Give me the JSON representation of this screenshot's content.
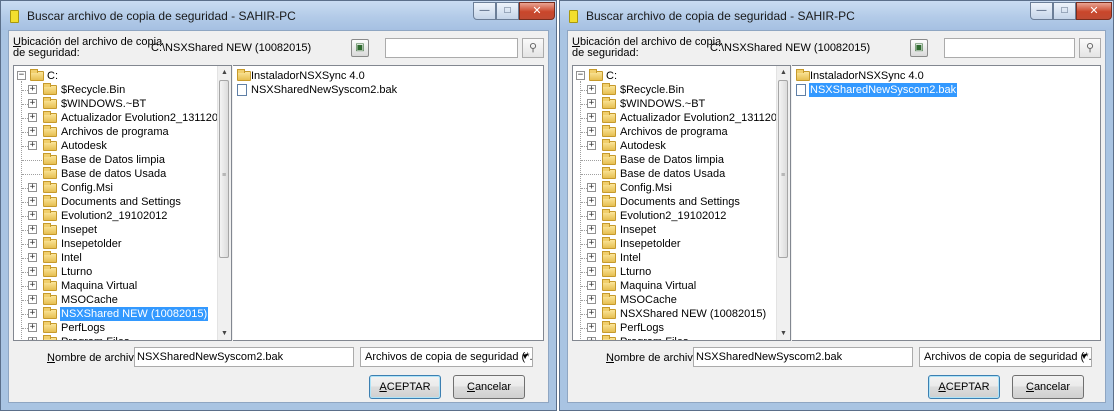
{
  "window": {
    "title": "Buscar archivo de copia de seguridad - SAHIR-PC",
    "minimize": "—",
    "maximize": "□",
    "close": "✕"
  },
  "location": {
    "label_line1_accesskey": "U",
    "label_line1_rest": "bicación del archivo de copia",
    "label_line2": "de seguridad:",
    "path": "C:\\NSXShared NEW (10082015)",
    "nav_icon": "folder-nav-icon",
    "search_value": "",
    "search_icon": "search-icon"
  },
  "tree": {
    "root": "C:",
    "items": [
      {
        "label": "$Recycle.Bin",
        "expandable": true
      },
      {
        "label": "$WINDOWS.~BT",
        "expandable": true
      },
      {
        "label": "Actualizador Evolution2_13112013",
        "expandable": true
      },
      {
        "label": "Archivos de programa",
        "expandable": true
      },
      {
        "label": "Autodesk",
        "expandable": true
      },
      {
        "label": "Base de Datos limpia",
        "expandable": false
      },
      {
        "label": "Base de datos Usada",
        "expandable": false
      },
      {
        "label": "Config.Msi",
        "expandable": true
      },
      {
        "label": "Documents and Settings",
        "expandable": true
      },
      {
        "label": "Evolution2_19102012",
        "expandable": true
      },
      {
        "label": "Insepet",
        "expandable": true
      },
      {
        "label": "Insepetolder",
        "expandable": true
      },
      {
        "label": "Intel",
        "expandable": true
      },
      {
        "label": "Lturno",
        "expandable": true
      },
      {
        "label": "Maquina Virtual",
        "expandable": true
      },
      {
        "label": "MSOCache",
        "expandable": true
      },
      {
        "label": "NSXShared NEW (10082015)",
        "expandable": true
      },
      {
        "label": "PerfLogs",
        "expandable": true
      },
      {
        "label": "Program Files",
        "expandable": true
      }
    ]
  },
  "files": [
    {
      "label": "InstaladorNSXSync 4.0",
      "type": "folder"
    },
    {
      "label": "NSXSharedNewSyscom2.bak",
      "type": "file"
    }
  ],
  "filename": {
    "label_accesskey": "N",
    "label_rest": "ombre de archivo:",
    "value": "NSXSharedNewSyscom2.bak"
  },
  "filetype": {
    "selected": "Archivos de copia de seguridad (*.bak"
  },
  "buttons": {
    "ok_accesskey": "A",
    "ok_rest": "CEPTAR",
    "cancel_accesskey": "C",
    "cancel_rest": "ancelar"
  },
  "scroll": {
    "up": "▲",
    "down": "▼",
    "grip": "≡"
  },
  "dialogs": [
    {
      "name": "left",
      "selected_tree_index": 16,
      "selected_file_index": -1
    },
    {
      "name": "right",
      "selected_tree_index": -1,
      "selected_file_index": 1
    }
  ]
}
